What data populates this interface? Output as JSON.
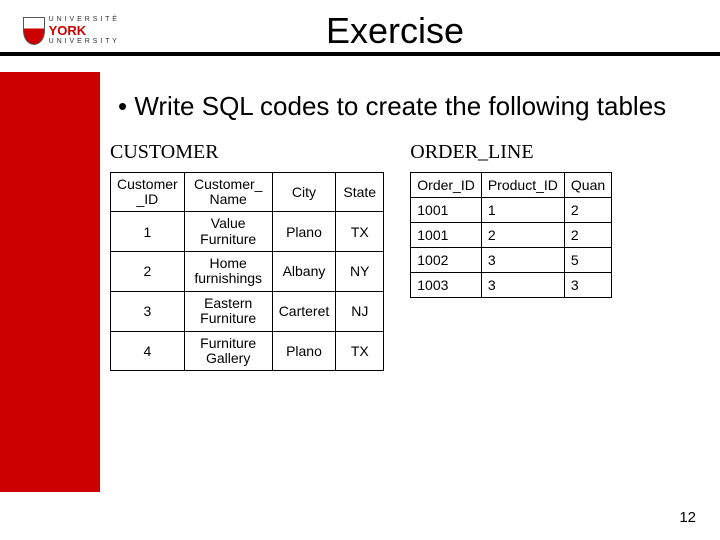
{
  "logo": {
    "line1": "U N I V E R S I T É",
    "brand": "YORK",
    "line3": "U N I V E R S I T Y"
  },
  "title": "Exercise",
  "bullet": "Write SQL codes to create the following tables",
  "customer": {
    "label": "CUSTOMER",
    "headers": [
      "Customer_ID",
      "Customer_Name",
      "City",
      "State"
    ],
    "rows": [
      {
        "id": "1",
        "name": "Value Furniture",
        "city": "Plano",
        "state": "TX"
      },
      {
        "id": "2",
        "name": "Home furnishings",
        "city": "Albany",
        "state": "NY"
      },
      {
        "id": "3",
        "name": "Eastern Furniture",
        "city": "Carteret",
        "state": "NJ"
      },
      {
        "id": "4",
        "name": "Furniture Gallery",
        "city": "Plano",
        "state": "TX"
      }
    ]
  },
  "orderline": {
    "label": "ORDER_LINE",
    "headers": [
      "Order_ID",
      "Product_ID",
      "Quan"
    ],
    "rows": [
      {
        "order": "1001",
        "product": "1",
        "quan": "2"
      },
      {
        "order": "1001",
        "product": "2",
        "quan": "2"
      },
      {
        "order": "1002",
        "product": "3",
        "quan": "5"
      },
      {
        "order": "1003",
        "product": "3",
        "quan": "3"
      }
    ]
  },
  "page_number": "12",
  "header_display": {
    "customer_id": "Customer\n_ID",
    "customer_name": "Customer_\nName"
  }
}
